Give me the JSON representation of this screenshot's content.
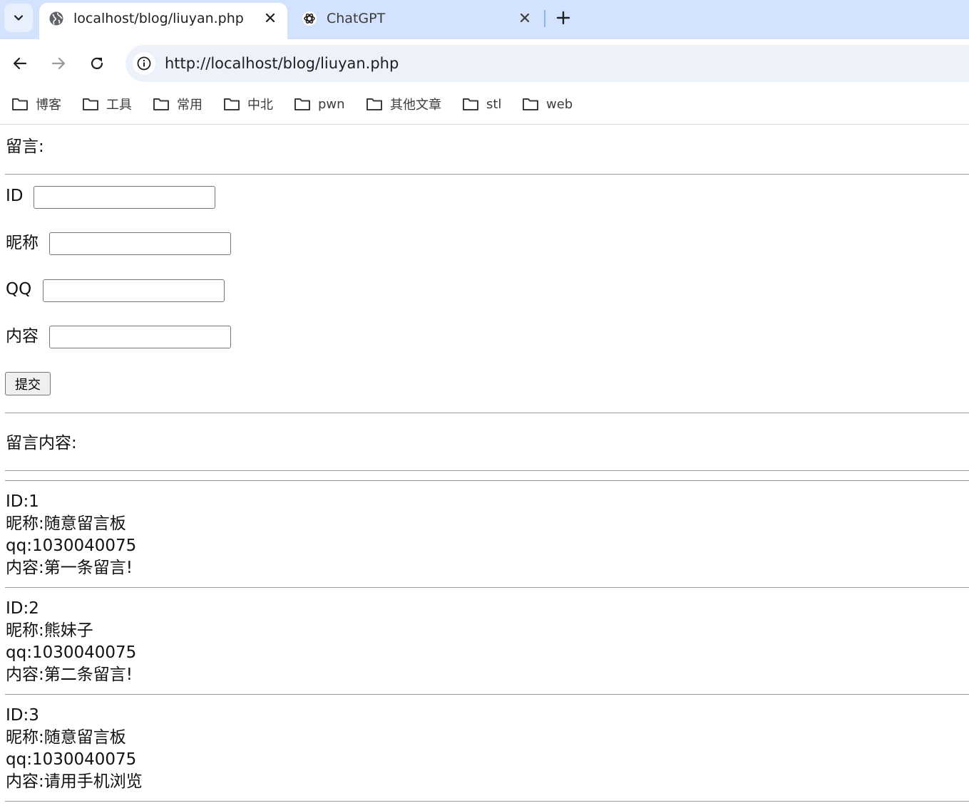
{
  "browser": {
    "tabs": [
      {
        "title": "localhost/blog/liuyan.php",
        "active": true
      },
      {
        "title": "ChatGPT",
        "active": false
      }
    ],
    "url": "http://localhost/blog/liuyan.php",
    "bookmarks": [
      "博客",
      "工具",
      "常用",
      "中北",
      "pwn",
      "其他文章",
      "stl",
      "web"
    ]
  },
  "page": {
    "heading": "留言:",
    "form": {
      "id_label": "ID",
      "nickname_label": "昵称",
      "qq_label": "QQ",
      "content_label": "内容",
      "submit_label": "提交"
    },
    "messages_heading": "留言内容:",
    "entries": [
      {
        "id": "ID:1",
        "nickname": "昵称:随意留言板",
        "qq": "qq:1030040075",
        "content": "内容:第一条留言!"
      },
      {
        "id": "ID:2",
        "nickname": "昵称:熊妹子",
        "qq": "qq:1030040075",
        "content": "内容:第二条留言!"
      },
      {
        "id": "ID:3",
        "nickname": "昵称:随意留言板",
        "qq": "qq:1030040075",
        "content": "内容:请用手机浏览"
      }
    ]
  },
  "colors": {
    "tabstrip": "#d3e3fd",
    "omnibox": "#edf2fa",
    "accent": "#8ab4f8"
  }
}
